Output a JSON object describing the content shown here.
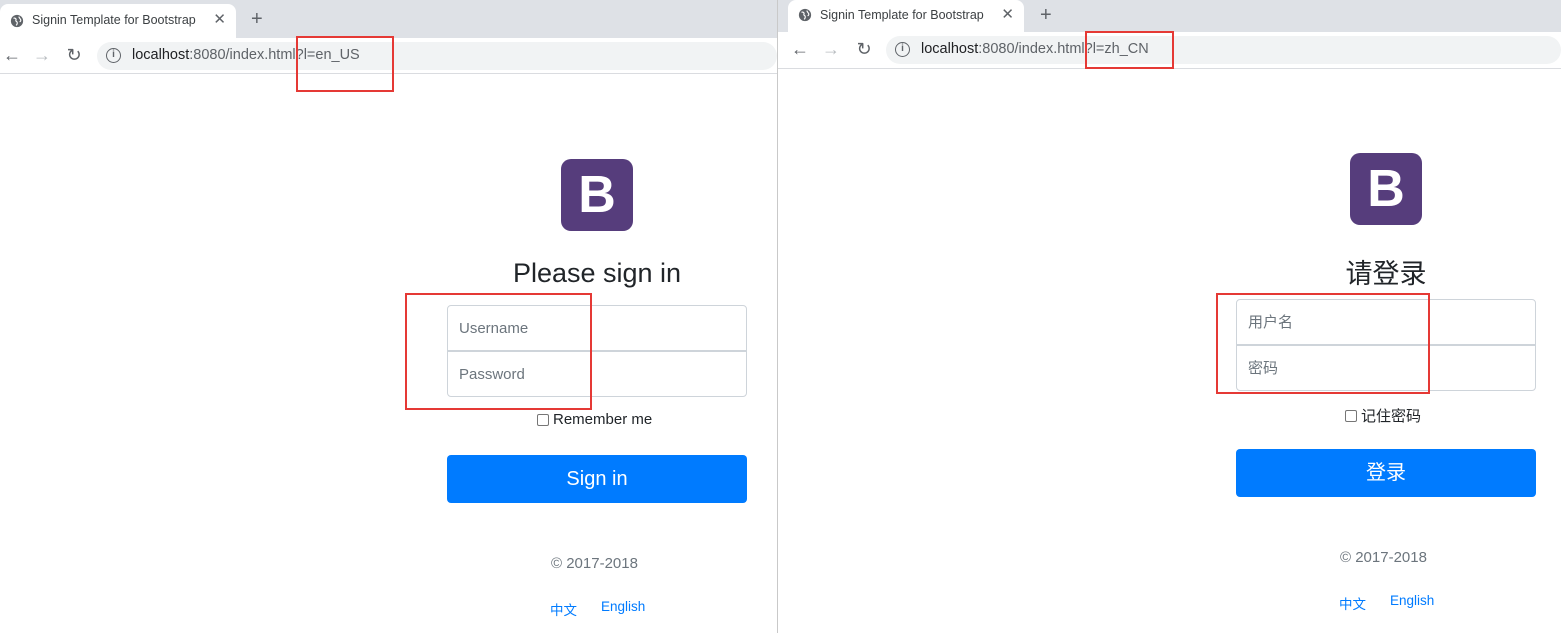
{
  "left": {
    "tab": {
      "title": "Signin Template for Bootstrap",
      "close": "✕",
      "new_tab": "+"
    },
    "nav": {
      "back": "←",
      "forward": "→",
      "reload": "↻",
      "info": "i"
    },
    "address": {
      "host": "localhost",
      "rest": ":8080/index.html?l=en_US"
    },
    "logo": "B",
    "heading": "Please sign in",
    "username_placeholder": "Username",
    "password_placeholder": "Password",
    "remember_label": "Remember me",
    "signin_button": "Sign in",
    "copyright": "© 2017-2018",
    "lang_zh": "中文",
    "lang_en": "English"
  },
  "right": {
    "tab": {
      "title": "Signin Template for Bootstrap",
      "close": "✕",
      "new_tab": "+"
    },
    "nav": {
      "back": "←",
      "forward": "→",
      "reload": "↻",
      "info": "i"
    },
    "address": {
      "host": "localhost",
      "rest": ":8080/index.html?l=zh_CN"
    },
    "logo": "B",
    "heading": "请登录",
    "username_placeholder": "用户名",
    "password_placeholder": "密码",
    "remember_label": "记住密码",
    "signin_button": "登录",
    "copyright": "© 2017-2018",
    "lang_zh": "中文",
    "lang_en": "English"
  },
  "colors": {
    "brand": "#563d7c",
    "primary": "#007bff",
    "annotation": "#e53935",
    "tabstrip": "#dee1e6"
  },
  "icons": [
    "globe-icon",
    "close-icon",
    "plus-icon",
    "back-arrow-icon",
    "forward-arrow-icon",
    "reload-icon",
    "info-icon"
  ]
}
